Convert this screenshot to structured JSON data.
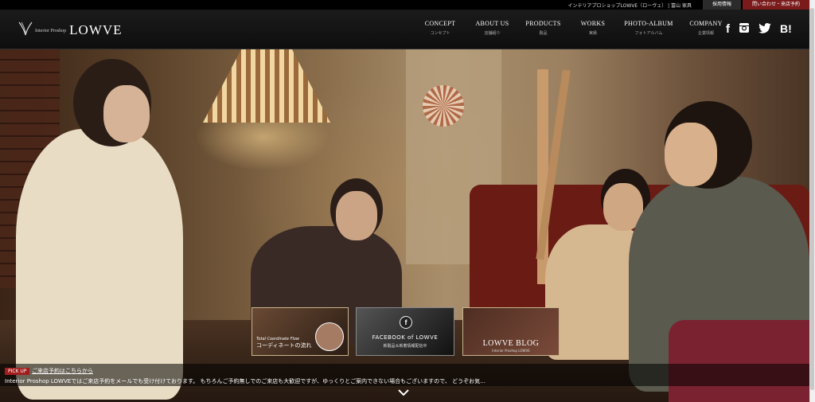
{
  "topbar": {
    "tagline": "インテリアプロショップLOWVE（ローヴェ） | 富山 家具",
    "recruit": "採用情報",
    "reserve": "問い合わせ・来店予約"
  },
  "logo": {
    "sub": "Interior Proshop",
    "main": "LOWVE"
  },
  "nav": [
    {
      "en": "CONCEPT",
      "ja": "コンセプト"
    },
    {
      "en": "ABOUT US",
      "ja": "店舗紹介"
    },
    {
      "en": "PRODUCTS",
      "ja": "製品"
    },
    {
      "en": "WORKS",
      "ja": "実績"
    },
    {
      "en": "PHOTO-ALBUM",
      "ja": "フォトアルバム"
    },
    {
      "en": "COMPANY",
      "ja": "企業情報"
    }
  ],
  "social": [
    "facebook-icon",
    "instagram-icon",
    "twitter-icon",
    "hatena-bookmark-icon"
  ],
  "social_text": {
    "facebook": "f",
    "hatena": "B!"
  },
  "banners": {
    "coordinate": {
      "subtitle": "Total Coordinate Flow",
      "title": "コーディネートの流れ"
    },
    "facebook": {
      "icon": "f",
      "title": "FACEBOOK of LOWVE",
      "subtitle": "新製品＆新着情報配信中"
    },
    "blog": {
      "title": "LOWVE BLOG",
      "subtitle": "Interior Proshop LOWVE"
    }
  },
  "pickup": {
    "badge": "PICK UP",
    "link": "ご来店予約はこちらから",
    "text": "Interior Proshop LOWVEではご来店予約をメールでも受け付けております。 もちろんご予約無しでのご来店も大歓迎ですが、ゆっくりとご案内できない場合もございますので、 どうぞお気…"
  },
  "colors": {
    "reserve": "#7a1a1a",
    "badge": "#a31d1d",
    "banner_border": "#c9b48a"
  }
}
